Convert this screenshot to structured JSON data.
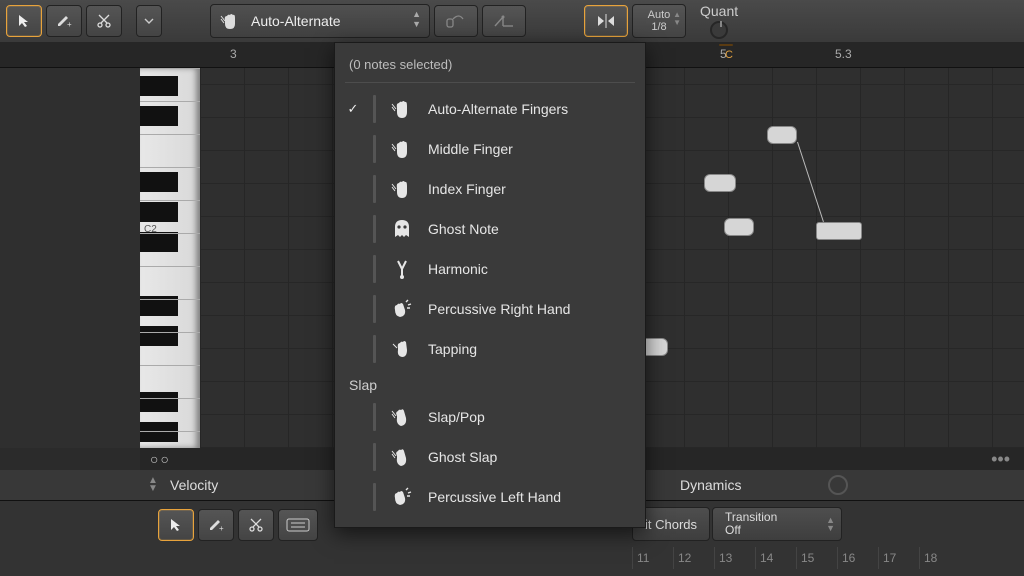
{
  "toolbar": {
    "articulation_selected": "Auto-Alternate",
    "snap_mode": "Auto",
    "snap_value": "1/8",
    "quantize_label": "Quant"
  },
  "ruler": {
    "mark_a": "3",
    "mark_b": "5",
    "mark_c": "5.3",
    "loop_label": "C"
  },
  "piano": {
    "octave_label": "C2"
  },
  "lanes": {
    "velocity_label": "Velocity",
    "dynamics_label": "Dynamics",
    "scroll_marks": "○○",
    "dots": "•••"
  },
  "bottom": {
    "tab_chords": "it Chords",
    "transition_label": "Transition",
    "transition_value": "Off",
    "ticks": [
      "11",
      "12",
      "13",
      "14",
      "15",
      "16",
      "17",
      "18"
    ]
  },
  "menu": {
    "header": "(0 notes selected)",
    "section_slap": "Slap",
    "items": [
      {
        "label": "Auto-Alternate Fingers",
        "checked": true,
        "stripe": "",
        "icon": "hand"
      },
      {
        "label": "Middle Finger",
        "checked": false,
        "stripe": "",
        "icon": "hand"
      },
      {
        "label": "Index Finger",
        "checked": false,
        "stripe": "",
        "icon": "hand"
      },
      {
        "label": "Ghost Note",
        "checked": false,
        "stripe": "purple",
        "icon": "ghost"
      },
      {
        "label": "Harmonic",
        "checked": false,
        "stripe": "purple",
        "icon": "fork"
      },
      {
        "label": "Percussive Right Hand",
        "checked": false,
        "stripe": "orange",
        "icon": "clap"
      },
      {
        "label": "Tapping",
        "checked": false,
        "stripe": "orange",
        "icon": "tap"
      }
    ],
    "slap_items": [
      {
        "label": "Slap/Pop",
        "stripe": "",
        "icon": "slap"
      },
      {
        "label": "Ghost Slap",
        "stripe": "",
        "icon": "slap"
      },
      {
        "label": "Percussive Left Hand",
        "stripe": "",
        "icon": "clap"
      }
    ]
  }
}
